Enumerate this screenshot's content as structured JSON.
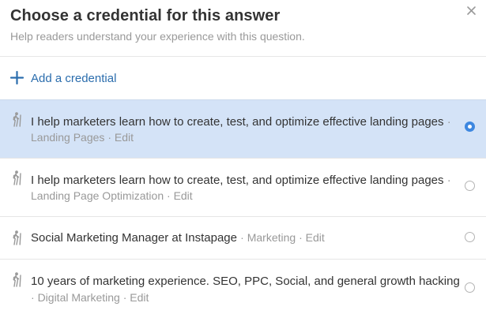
{
  "dialog": {
    "title": "Choose a credential for this answer",
    "subtitle": "Help readers understand your experience with this question.",
    "close_icon": "close-icon"
  },
  "add_credential": {
    "label": "Add a credential",
    "icon": "plus-icon"
  },
  "credentials": [
    {
      "text": "I help marketers learn how to create, test, and optimize effective landing pages",
      "separator": "·",
      "topic": "Landing Pages",
      "edit": "Edit",
      "selected": true
    },
    {
      "text": "I help marketers learn how to create, test, and optimize effective landing pages",
      "separator": "·",
      "topic": "Landing Page Optimization",
      "edit": "Edit",
      "selected": false
    },
    {
      "text": "Social Marketing Manager at Instapage",
      "separator": "·",
      "topic": "Marketing",
      "edit": "Edit",
      "selected": false
    },
    {
      "text": "10 years of marketing experience. SEO, PPC, Social, and general growth hacking",
      "separator": "·",
      "topic": "Digital Marketing",
      "edit": "Edit",
      "selected": false
    }
  ],
  "colors": {
    "accent": "#2b6dad",
    "selected_row": "#d4e3f7",
    "radio_checked": "#3d87e0",
    "muted_text": "#999999"
  }
}
